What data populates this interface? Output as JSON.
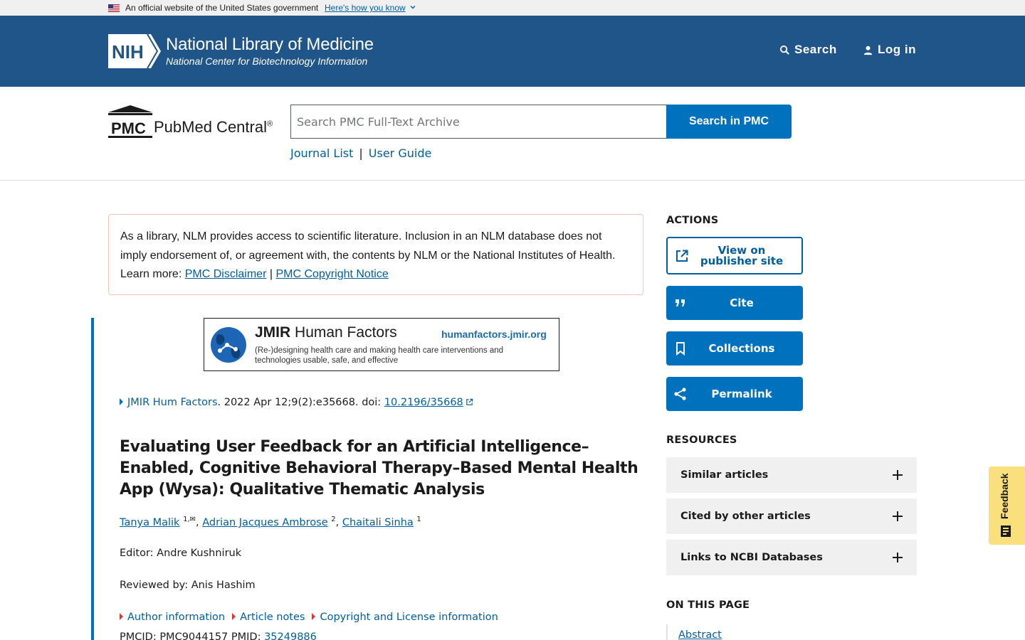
{
  "gov_banner": {
    "text": "An official website of the United States government",
    "link": "Here's how you know"
  },
  "nih_header": {
    "logo_text": "NIH",
    "title": "National Library of Medicine",
    "subtitle": "National Center for Biotechnology Information",
    "search_label": "Search",
    "login_label": "Log in"
  },
  "pmc_header": {
    "logo_text": "PMC",
    "wordmark": "PubMed Central",
    "wordmark_mark": "®",
    "search_placeholder": "Search PMC Full-Text Archive",
    "search_button": "Search in PMC",
    "links": [
      "Journal List",
      "User Guide"
    ],
    "separator": "|"
  },
  "disclaimer": {
    "text": "As a library, NLM provides access to scientific literature. Inclusion in an NLM database does not imply endorsement of, or agreement with, the contents by NLM or the National Institutes of Health.",
    "learn_more": "Learn more:",
    "link1": "PMC Disclaimer",
    "separator": "|",
    "link2": "PMC Copyright Notice"
  },
  "journal_banner": {
    "title_bold": "JMIR",
    "title_rest": "Human Factors",
    "url": "humanfactors.jmir.org",
    "description": "(Re-)designing health care and making health care interventions and technologies usable, safe, and effective"
  },
  "citation": {
    "journal": "JMIR Hum Factors",
    "details": ". 2022 Apr 12;9(2):e35668. doi: ",
    "doi": "10.2196/35668"
  },
  "article": {
    "title": "Evaluating User Feedback for an Artificial Intelligence–Enabled, Cognitive Behavioral Therapy–Based Mental Health App (Wysa): Qualitative Thematic Analysis",
    "authors": [
      {
        "name": "Tanya Malik",
        "sup": "1,✉"
      },
      {
        "name": "Adrian Jacques Ambrose",
        "sup": "2"
      },
      {
        "name": "Chaitali Sinha",
        "sup": "1"
      }
    ],
    "editor": "Editor: Andre Kushniruk",
    "reviewed": "Reviewed by: Anis Hashim",
    "info_links": [
      "Author information",
      "Article notes",
      "Copyright and License information"
    ],
    "ids_prefix": "PMCID: PMC9044157  PMID: ",
    "pmid": "35249886"
  },
  "sidebar": {
    "actions_heading": "ACTIONS",
    "actions": {
      "publisher_line1": "View on",
      "publisher_line2": "publisher site",
      "cite": "Cite",
      "collections": "Collections",
      "permalink": "Permalink"
    },
    "resources_heading": "RESOURCES",
    "resources": [
      "Similar articles",
      "Cited by other articles",
      "Links to NCBI Databases"
    ],
    "on_this_page_heading": "ON THIS PAGE",
    "on_this_page_first": "Abstract"
  },
  "feedback_label": "Feedback",
  "colors": {
    "nih_blue": "#20558a",
    "primary_button": "#0071bc",
    "link": "#005ea2",
    "feedback_bg": "#fadf7d",
    "alert_border": "#f2c4b8"
  }
}
